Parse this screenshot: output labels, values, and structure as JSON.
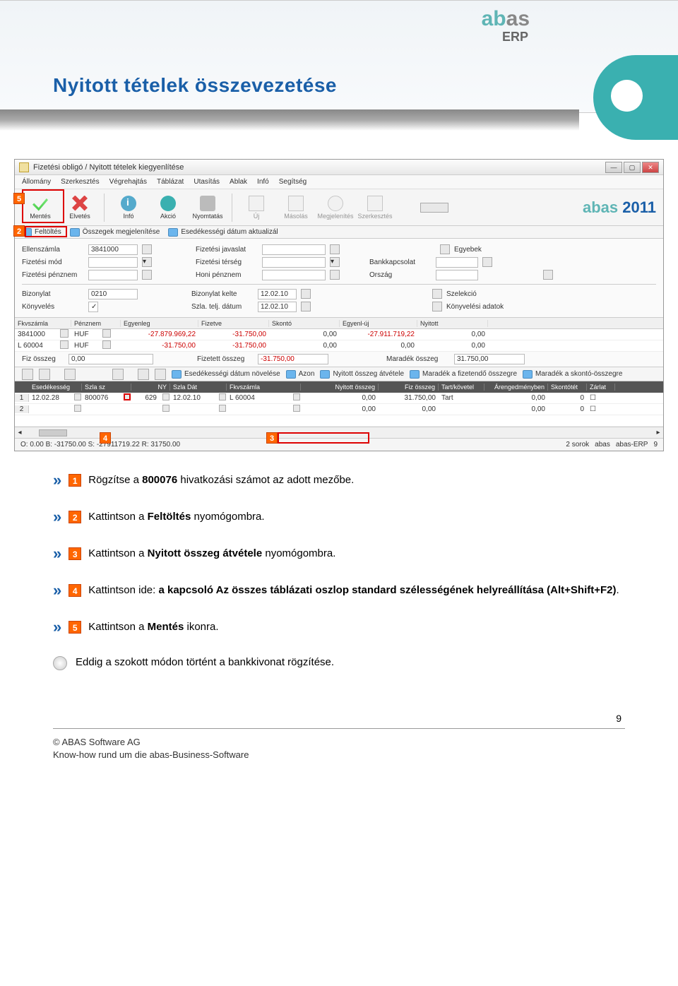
{
  "banner": {
    "logo_text": "abas",
    "logo_sub": "ERP",
    "title": "Nyitott tételek összevezetése"
  },
  "window": {
    "title": "Fizetési obligó / Nyitott tételek kiegyenlítése",
    "menu": [
      "Állomány",
      "Szerkesztés",
      "Végrehajtás",
      "Táblázat",
      "Utasítás",
      "Ablak",
      "Infó",
      "Segítség"
    ],
    "toolbar": {
      "mentes": "Mentés",
      "elvetes": "Elvetés",
      "info": "Infó",
      "akcio": "Akció",
      "nyomtatas": "Nyomtatás",
      "uj": "Új",
      "masolas": "Másolás",
      "megjelenites": "Megjelenítés",
      "szerkesztes": "Szerkesztés"
    },
    "brand": "abas 2011",
    "subtoolbar": {
      "feltoltes": "Feltöltés",
      "osszegek": "Összegek megjelenítése",
      "esedekesseg": "Esedékességi dátum aktualizál"
    },
    "form": {
      "ellenszamla_lbl": "Ellenszámla",
      "ellenszamla_val": "3841000",
      "fizmod_lbl": "Fizetési mód",
      "fizpenznem_lbl": "Fizetési pénznem",
      "fizjavaslat_lbl": "Fizetési javaslat",
      "fizterseg_lbl": "Fizetési térség",
      "honipenznem_lbl": "Honi pénznem",
      "egyebek_lbl": "Egyebek",
      "bankkapcsolat_lbl": "Bankkapcsolat",
      "orszag_lbl": "Ország",
      "bizonylat_lbl": "Bizonylat",
      "bizonylat_val": "0210",
      "konyveles_lbl": "Könyvelés",
      "bizkelte_lbl": "Bizonylat kelte",
      "bizkelte_val": "12.02.10",
      "szladatum_lbl": "Szla. telj. dátum",
      "szladatum_val": "12.02.10",
      "szelekcio_lbl": "Szelekció",
      "konyvadatok_lbl": "Könyvelési adatok"
    },
    "grid1": {
      "headers": [
        "Fkvszámla",
        "Pénznem",
        "Egyenleg",
        "Fizetve",
        "Skontó",
        "Egyenl-új",
        "Nyitott"
      ],
      "rows": [
        {
          "fkv": "3841000",
          "penznem": "HUF",
          "egyenleg": "-27.879.969,22",
          "fizetve": "-31.750,00",
          "skonto": "0,00",
          "egyenluj": "-27.911.719,22",
          "nyitott": "0,00"
        },
        {
          "fkv": "L 60004",
          "penznem": "HUF",
          "egyenleg": "-31.750,00",
          "fizetve": "-31.750,00",
          "skonto": "0,00",
          "egyenluj": "0,00",
          "nyitott": "0,00"
        }
      ]
    },
    "summary": {
      "fizosszeg_lbl": "Fiz összeg",
      "fizosszeg_val": "0,00",
      "fizetett_lbl": "Fizetett összeg",
      "fizetett_val": "-31.750,00",
      "maradek_lbl": "Maradék összeg",
      "maradek_val": "31.750,00"
    },
    "actionbar": {
      "esed_novel": "Esedékességi dátum növelése",
      "azon": "Azon",
      "nyitott_atvetele": "Nyitott összeg átvétele",
      "maradek_fizetendo": "Maradék a fizetendő összegre",
      "maradek_skonto": "Maradék a skontó-összegre"
    },
    "grid2": {
      "headers": [
        "",
        "Esedékesség",
        "Szla sz",
        "NY",
        "Szla Dát",
        "Fkvszámla",
        "Nyitott összeg",
        "Fiz összeg",
        "Tart/követel",
        "Árengedményben",
        "Skontótét",
        "Zárlat"
      ],
      "rows": [
        {
          "n": "1",
          "esed": "12.02.28",
          "szla": "800076",
          "ny": "629",
          "dat": "12.02.10",
          "fkv": "L 60004",
          "nyitott": "0,00",
          "fiz": "31.750,00",
          "tart": "Tart",
          "areng": "0,00",
          "skonto": "0"
        },
        {
          "n": "2",
          "esed": "",
          "szla": "",
          "ny": "",
          "dat": "",
          "fkv": "",
          "nyitott": "0,00",
          "fiz": "0,00",
          "tart": "",
          "areng": "0,00",
          "skonto": "0"
        }
      ]
    },
    "statusbar": {
      "left": "O: 0.00  B: -31750.00  S: -27911719.22  R: 31750.00",
      "right": [
        "2 sorok",
        "abas",
        "abas-ERP",
        "9"
      ]
    }
  },
  "callouts": {
    "c1": "1",
    "c2": "2",
    "c3": "3",
    "c4": "4",
    "c5": "5"
  },
  "instructions": [
    {
      "num": "1",
      "text_before": "Rögzítse a ",
      "bold": "800076",
      "text_after": " hivatkozási számot az adott mezőbe."
    },
    {
      "num": "2",
      "text_before": "Kattintson a ",
      "bold": "Feltöltés",
      "text_after": " nyomógombra."
    },
    {
      "num": "3",
      "text_before": "Kattintson a ",
      "bold": "Nyitott összeg átvétele",
      "text_after": " nyomógombra."
    },
    {
      "num": "4",
      "text_before": "Kattintson ide: ",
      "bold": "a kapcsoló Az összes táblázati oszlop standard szélességének helyreállítása (Alt+Shift+F2)",
      "text_after": "."
    },
    {
      "num": "5",
      "text_before": "Kattintson  a ",
      "bold": "Mentés",
      "text_after": " ikonra."
    }
  ],
  "note": "Eddig  a  szokott  módon  történt  a  bankkivonat  rögzítése.",
  "page_number": "9",
  "footer": {
    "company": "©  ABAS  Software  AG",
    "tagline": "Know-how  rund  um  die  abas-Business-Software"
  }
}
